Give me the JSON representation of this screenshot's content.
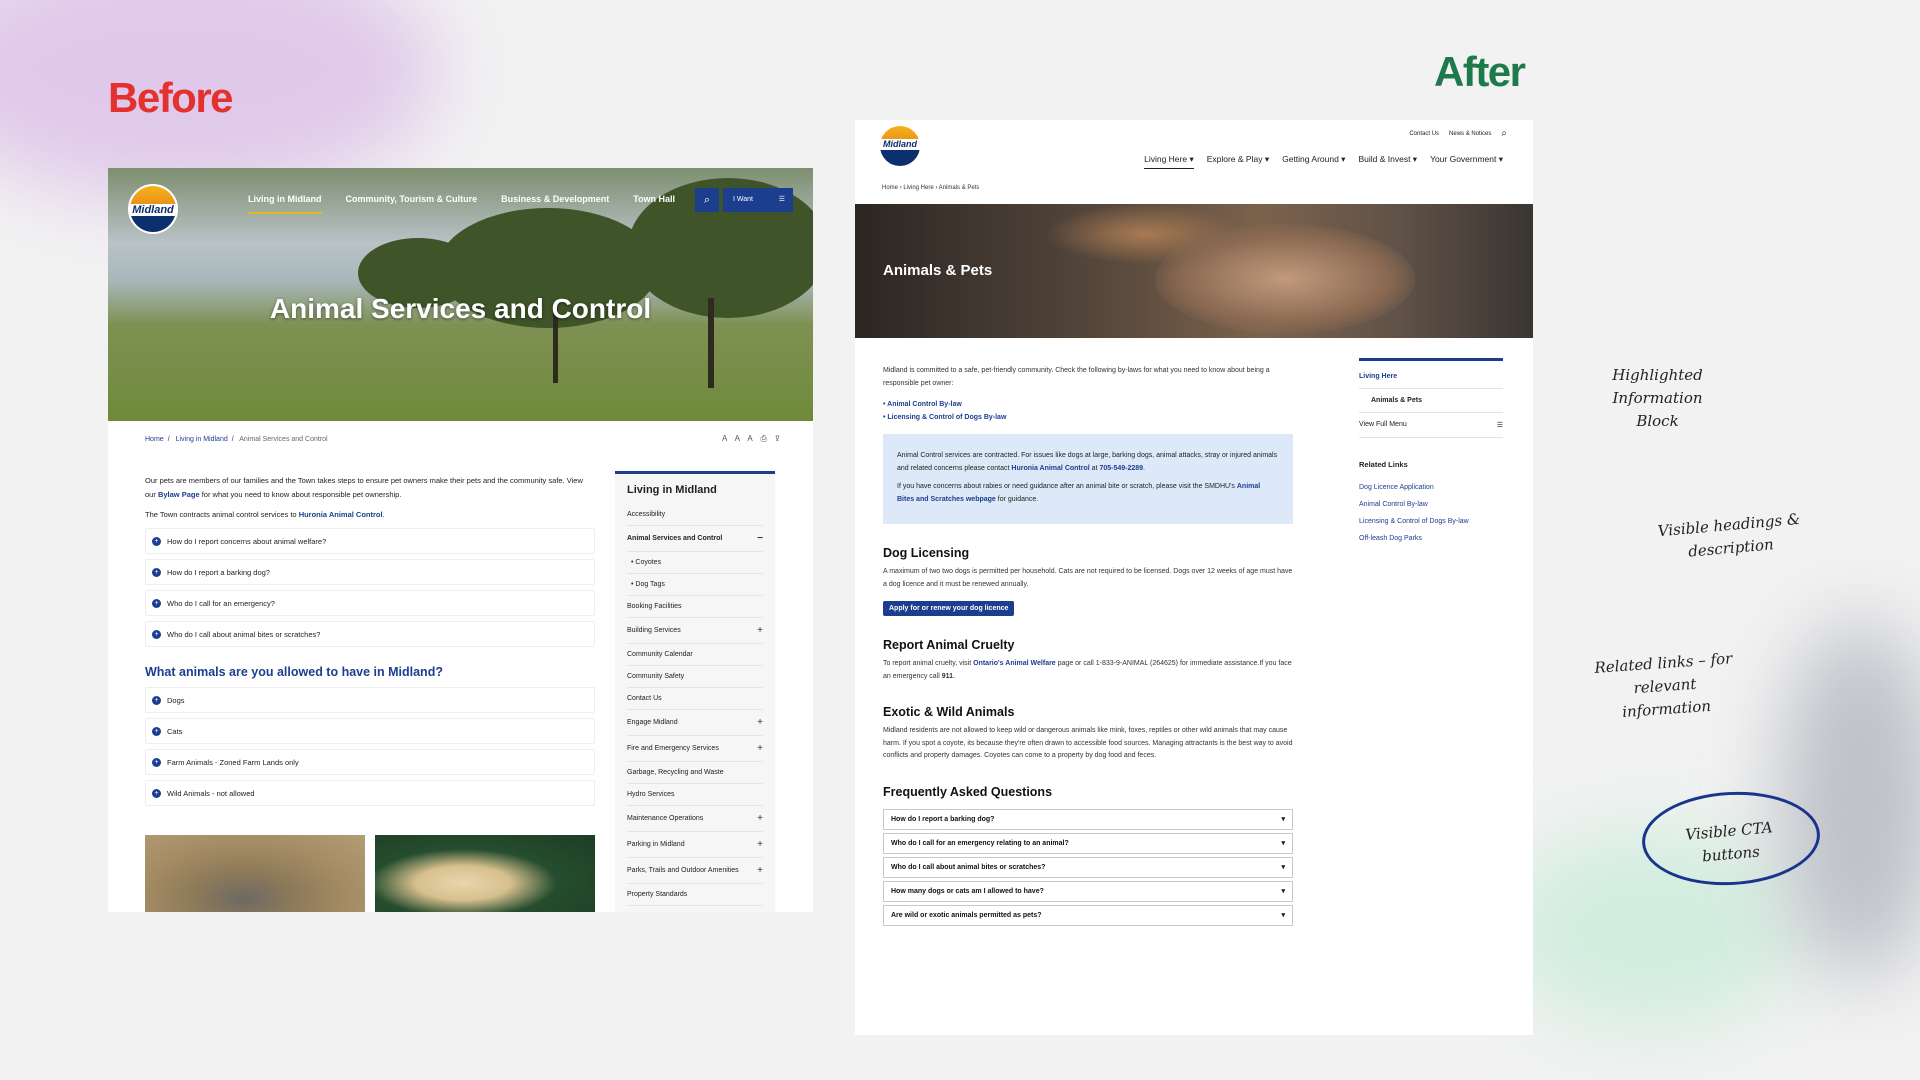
{
  "labels": {
    "before": "Before",
    "after": "After"
  },
  "colors": {
    "before": "#e3312d",
    "after": "#1e7a4a",
    "brand_blue": "#1c3e8f",
    "info_bg": "#dde9f8"
  },
  "before": {
    "logo": "Midland",
    "nav": [
      "Living in Midland",
      "Community, Tourism & Culture",
      "Business & Development",
      "Town Hall"
    ],
    "iwant": "I Want",
    "hero_title": "Animal Services and Control",
    "breadcrumb": {
      "home": "Home",
      "parent": "Living in Midland",
      "current": "Animal Services and Control"
    },
    "tools": "A A A",
    "intro_1_a": "Our pets are members of our families and the Town takes steps to ensure pet owners make their pets and the community safe. View our ",
    "intro_1_link": "Bylaw Page",
    "intro_1_b": " for what you need to know about responsible pet ownership.",
    "intro_2_a": "The Town contracts animal control services to ",
    "intro_2_link": "Huronia Animal Control",
    "intro_2_b": ".",
    "faq": [
      "How do I report concerns about animal welfare?",
      "How do I report a barking dog?",
      "Who do I call for an emergency?",
      "Who do I call about animal bites or scratches?"
    ],
    "animals_heading": "What animals are you allowed to have in Midland?",
    "animals": [
      "Dogs",
      "Cats",
      "Farm Animals - Zoned Farm Lands only",
      "Wild Animals - not allowed"
    ],
    "sidebar": {
      "title": "Living in Midland",
      "items": [
        {
          "label": "Accessibility",
          "icon": ""
        },
        {
          "label": "Animal Services and Control",
          "icon": "−"
        },
        {
          "label": "• Coyotes",
          "icon": ""
        },
        {
          "label": "• Dog Tags",
          "icon": ""
        },
        {
          "label": "Booking Facilities",
          "icon": ""
        },
        {
          "label": "Building Services",
          "icon": "+"
        },
        {
          "label": "Community Calendar",
          "icon": ""
        },
        {
          "label": "Community Safety",
          "icon": ""
        },
        {
          "label": "Contact Us",
          "icon": ""
        },
        {
          "label": "Engage Midland",
          "icon": "+"
        },
        {
          "label": "Fire and Emergency Services",
          "icon": "+"
        },
        {
          "label": "Garbage, Recycling and Waste",
          "icon": ""
        },
        {
          "label": "Hydro Services",
          "icon": ""
        },
        {
          "label": "Maintenance Operations",
          "icon": "+"
        },
        {
          "label": "Parking in Midland",
          "icon": "+"
        },
        {
          "label": "Parks, Trails and Outdoor Amenities",
          "icon": "+"
        },
        {
          "label": "Property Standards",
          "icon": ""
        }
      ]
    }
  },
  "after": {
    "logo": "Midland",
    "util": [
      "Contact Us",
      "News & Notices"
    ],
    "nav": [
      "Living Here ▾",
      "Explore & Play ▾",
      "Getting Around ▾",
      "Build & Invest ▾",
      "Your Government ▾"
    ],
    "breadcrumb": "Home ›  Living Here ›  Animals & Pets",
    "hero_title": "Animals & Pets",
    "intro": "Midland is committed to a safe, pet-friendly community. Check the following by-laws for what you need to know about being a responsible pet owner:",
    "bylaw_links": [
      "• Animal Control By-law",
      "• Licensing & Control of Dogs By-law"
    ],
    "info_1_a": "Animal Control services are contracted. For issues like dogs at large, barking dogs, animal attacks, stray or injured animals and related concerns please contact ",
    "info_1_link": "Huronia Animal Control",
    "info_1_b": " at ",
    "info_1_phone": "705-549-2289",
    "info_1_c": ".",
    "info_2_a": "If you have concerns about rabies or need guidance after an animal bite or scratch, please visit the SMDHU's ",
    "info_2_link": "Animal Bites and Scratches webpage",
    "info_2_b": " for guidance.",
    "dog_heading": "Dog Licensing",
    "dog_text": "A maximum of two two dogs is permitted per household. Cats are not required to be licensed. Dogs over 12 weeks of age must have a dog licence and it must be renewed annually.",
    "dog_button": "Apply for or renew your dog licence",
    "cruelty_heading": "Report Animal Cruelty",
    "cruelty_a": "To report animal cruelty, visit ",
    "cruelty_link": "Ontario's Animal Welfare",
    "cruelty_b": " page or call 1-833-9-ANIMAL (264625) for immediate assistance.If you face an emergency call ",
    "cruelty_911": "911",
    "cruelty_c": ".",
    "exotic_heading": "Exotic & Wild Animals",
    "exotic_text": "Midland residents are not allowed to keep wild or dangerous animals like mink, foxes, reptiles or other wild animals that may cause harm. If you spot a coyote, its because they're often drawn to accessible food sources. Managing attractants is the best way to avoid conflicts and property damages. Coyotes can come to a property by dog food and feces.",
    "faq_heading": "Frequently Asked Questions",
    "faq": [
      "How do I report a barking dog?",
      "Who do I call for an emergency relating to an animal?",
      "Who do I call about animal bites or scratches?",
      "How many dogs or cats am I allowed to have?",
      "Are wild or exotic animals permitted as pets?"
    ],
    "sidebar": {
      "top": "Living Here",
      "sub": "Animals & Pets",
      "view_full": "View Full Menu",
      "related_heading": "Related Links",
      "related": [
        "Dog Licence Application",
        "Animal Control By-law",
        "Licensing & Control of Dogs By-law",
        "Off-leash Dog Parks"
      ]
    }
  },
  "annotations": {
    "highlighted": "Highlighted Information Block",
    "headings": "Visible headings & description",
    "related": "Related links – for relevant information",
    "cta": "Visible CTA buttons"
  }
}
